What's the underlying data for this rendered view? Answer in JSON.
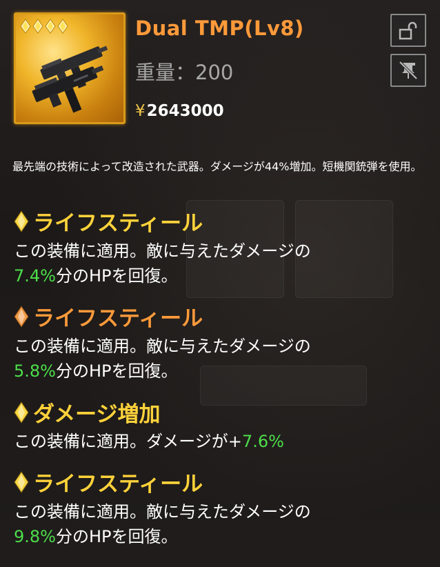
{
  "item": {
    "name": "Dual TMP(Lv8)",
    "weight_label": "重量：",
    "weight_value": "200",
    "price_symbol": "¥",
    "price_value": "2643000",
    "stars": 4,
    "description": "最先端の技術によって改造された武器。ダメージが44%増加。短機関銃弾を使用。"
  },
  "buttons": {
    "lock_icon": "unlock-icon",
    "unequip_icon": "no-pin-icon"
  },
  "effects": [
    {
      "title": "ライフスティール",
      "title_color": "#ffd23a",
      "gem_color": "#f7d642",
      "body_prefix": "この装備に適用。敵に与えたダメージの",
      "value": "7.4%",
      "body_suffix": "分のHPを回復。"
    },
    {
      "title": "ライフスティール",
      "title_color": "#ff9a3a",
      "gem_color": "#f09a46",
      "body_prefix": "この装備に適用。敵に与えたダメージの",
      "value": "5.8%",
      "body_suffix": "分のHPを回復。"
    },
    {
      "title": "ダメージ増加",
      "title_color": "#ffd23a",
      "gem_color": "#f7d642",
      "body_prefix": "この装備に適用。ダメージが+",
      "value": "7.6%",
      "body_suffix": ""
    },
    {
      "title": "ライフスティール",
      "title_color": "#ffd23a",
      "gem_color": "#f7d642",
      "body_prefix": "この装備に適用。敵に与えたダメージの",
      "value": "9.8%",
      "body_suffix": "分のHPを回復。"
    }
  ],
  "colors": {
    "accent_orange": "#ff9a3a",
    "accent_gold": "#ffd23a",
    "value_green": "#4dde4a",
    "frame_gold": "#d99a19"
  }
}
